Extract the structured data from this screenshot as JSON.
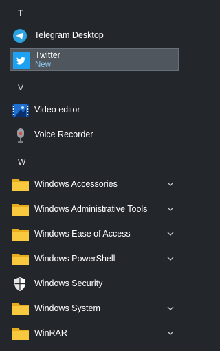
{
  "sections": {
    "t_letter": "T",
    "v_letter": "V",
    "w_letter": "W"
  },
  "apps": {
    "telegram": {
      "label": "Telegram Desktop",
      "icon": "telegram-icon"
    },
    "twitter": {
      "label": "Twitter",
      "sublabel": "New",
      "icon": "twitter-icon"
    },
    "video_editor": {
      "label": "Video editor",
      "icon": "video-editor-icon"
    },
    "voice_recorder": {
      "label": "Voice Recorder",
      "icon": "microphone-icon"
    },
    "windows_accessories": {
      "label": "Windows Accessories",
      "icon": "folder-icon"
    },
    "windows_admin_tools": {
      "label": "Windows Administrative Tools",
      "icon": "folder-icon"
    },
    "windows_ease": {
      "label": "Windows Ease of Access",
      "icon": "folder-icon"
    },
    "windows_powershell": {
      "label": "Windows PowerShell",
      "icon": "folder-icon"
    },
    "windows_security": {
      "label": "Windows Security",
      "icon": "shield-icon"
    },
    "windows_system": {
      "label": "Windows System",
      "icon": "folder-icon"
    },
    "winrar": {
      "label": "WinRAR",
      "icon": "folder-icon"
    }
  },
  "colors": {
    "background": "#23272c",
    "highlight": "#50565d",
    "accent_text": "#8ec8f4",
    "folder": "#f5c336"
  }
}
